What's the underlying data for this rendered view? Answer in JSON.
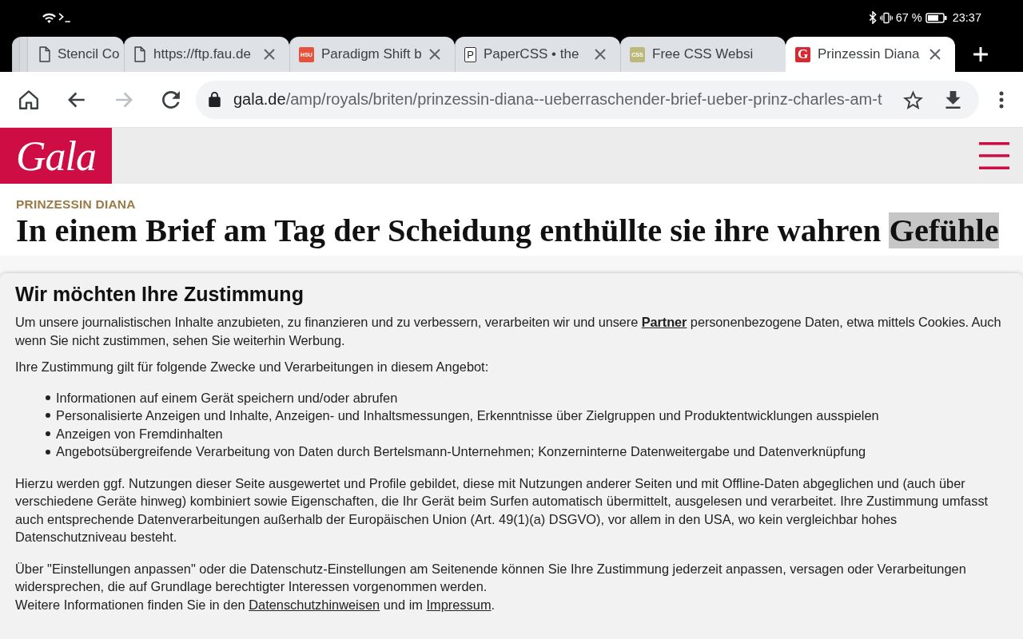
{
  "status_bar": {
    "battery": "67 %",
    "time": "23:37"
  },
  "tabs": [
    {
      "title": "Stencil Co",
      "favicon": {
        "kind": "page"
      },
      "closable": false,
      "stacked": true,
      "selected": false
    },
    {
      "title": "https://ftp.fau.de",
      "favicon": {
        "kind": "page"
      },
      "closable": true,
      "stacked": false,
      "selected": false
    },
    {
      "title": "Paradigm Shift b",
      "favicon": {
        "kind": "badge",
        "text": "HSU",
        "color": "#e5533c"
      },
      "closable": true,
      "stacked": false,
      "selected": false
    },
    {
      "title": "PaperCSS • the",
      "favicon": {
        "kind": "outlined",
        "text": "P"
      },
      "closable": true,
      "stacked": false,
      "selected": false
    },
    {
      "title": "Free CSS Websi",
      "favicon": {
        "kind": "badge",
        "text": "CSS",
        "color": "#bdb97c"
      },
      "closable": false,
      "stacked": false,
      "selected": false
    },
    {
      "title": "Prinzessin Diana",
      "favicon": {
        "kind": "badge",
        "text": "G",
        "color": "#d42a34"
      },
      "closable": true,
      "stacked": false,
      "selected": true
    }
  ],
  "nav_buttons": [
    {
      "kind": "home",
      "disabled": false
    },
    {
      "kind": "back",
      "disabled": false
    },
    {
      "kind": "forward",
      "disabled": true
    },
    {
      "kind": "reload",
      "disabled": false
    }
  ],
  "address_bar": {
    "host": "gala.de",
    "path": "/amp/royals/briten/prinzessin-diana--ueberraschender-brief-ueber-prinz-charles-am-t"
  },
  "site_header": {
    "logo": "Gala"
  },
  "article": {
    "kicker": "PRINZESSIN DIANA",
    "headline": "In einem Brief am Tag der Scheidung enthüllte sie ihre wahren",
    "headline_selected": "Gefühle"
  },
  "consent": {
    "title": "Wir möchten Ihre Zustimmung",
    "intro": {
      "before": "Um unsere journalistischen Inhalte anzubieten, zu finanzieren und zu verbessern, verarbeiten wir und unsere",
      "link": "Partner",
      "after": "personenbezogene Daten, etwa mittels Cookies. Auch wenn Sie nicht zustimmen, sehen Sie weiterhin Werbung."
    },
    "purposes_intro": "Ihre Zustimmung gilt für folgende Zwecke und Verarbeitungen in diesem Angebot:",
    "purposes": [
      "Informationen auf einem Gerät speichern und/oder abrufen",
      "Personalisierte Anzeigen und Inhalte, Anzeigen- und Inhaltsmessungen, Erkenntnisse über Zielgruppen und Produktentwicklungen ausspielen",
      "Anzeigen von Fremdinhalten",
      "Angebotsübergreifende Verarbeitung von Daten durch Bertelsmann-Unternehmen; Konzerninterne Datenweitergabe und Datenverknüpfung"
    ],
    "details": "Hierzu werden ggf. Nutzungen dieser Seite ausgewertet und Profile gebildet, diese mit Nutzungen anderer Seiten und mit Offline-Daten abgeglichen und (auch über verschiedene Geräte hinweg) kombiniert sowie Eigenschaften, die Ihr Gerät beim Surfen automatisch übermittelt, ausgelesen und verarbeitet. Ihre Zustimmung umfasst auch entsprechende Datenverarbeitungen außerhalb der Europäischen Union (Art. 49(1)(a) DSGVO), vor allem in den USA, wo kein vergleichbar hohes Datenschutzniveau besteht.",
    "settings": "Über \"Einstellungen anpassen\" oder die Datenschutz-Einstellungen am Seitenende können Sie Ihre Zustimmung jederzeit anpassen, versagen oder Verarbeitungen widersprechen, die auf Grundlage berechtigter Interessen vorgenommen werden.",
    "more_info": {
      "before": "Weitere Informationen finden Sie in den",
      "link_1": "Datenschutzhinweisen",
      "middle": "und im",
      "link_2": "Impressum",
      "after": "."
    }
  }
}
